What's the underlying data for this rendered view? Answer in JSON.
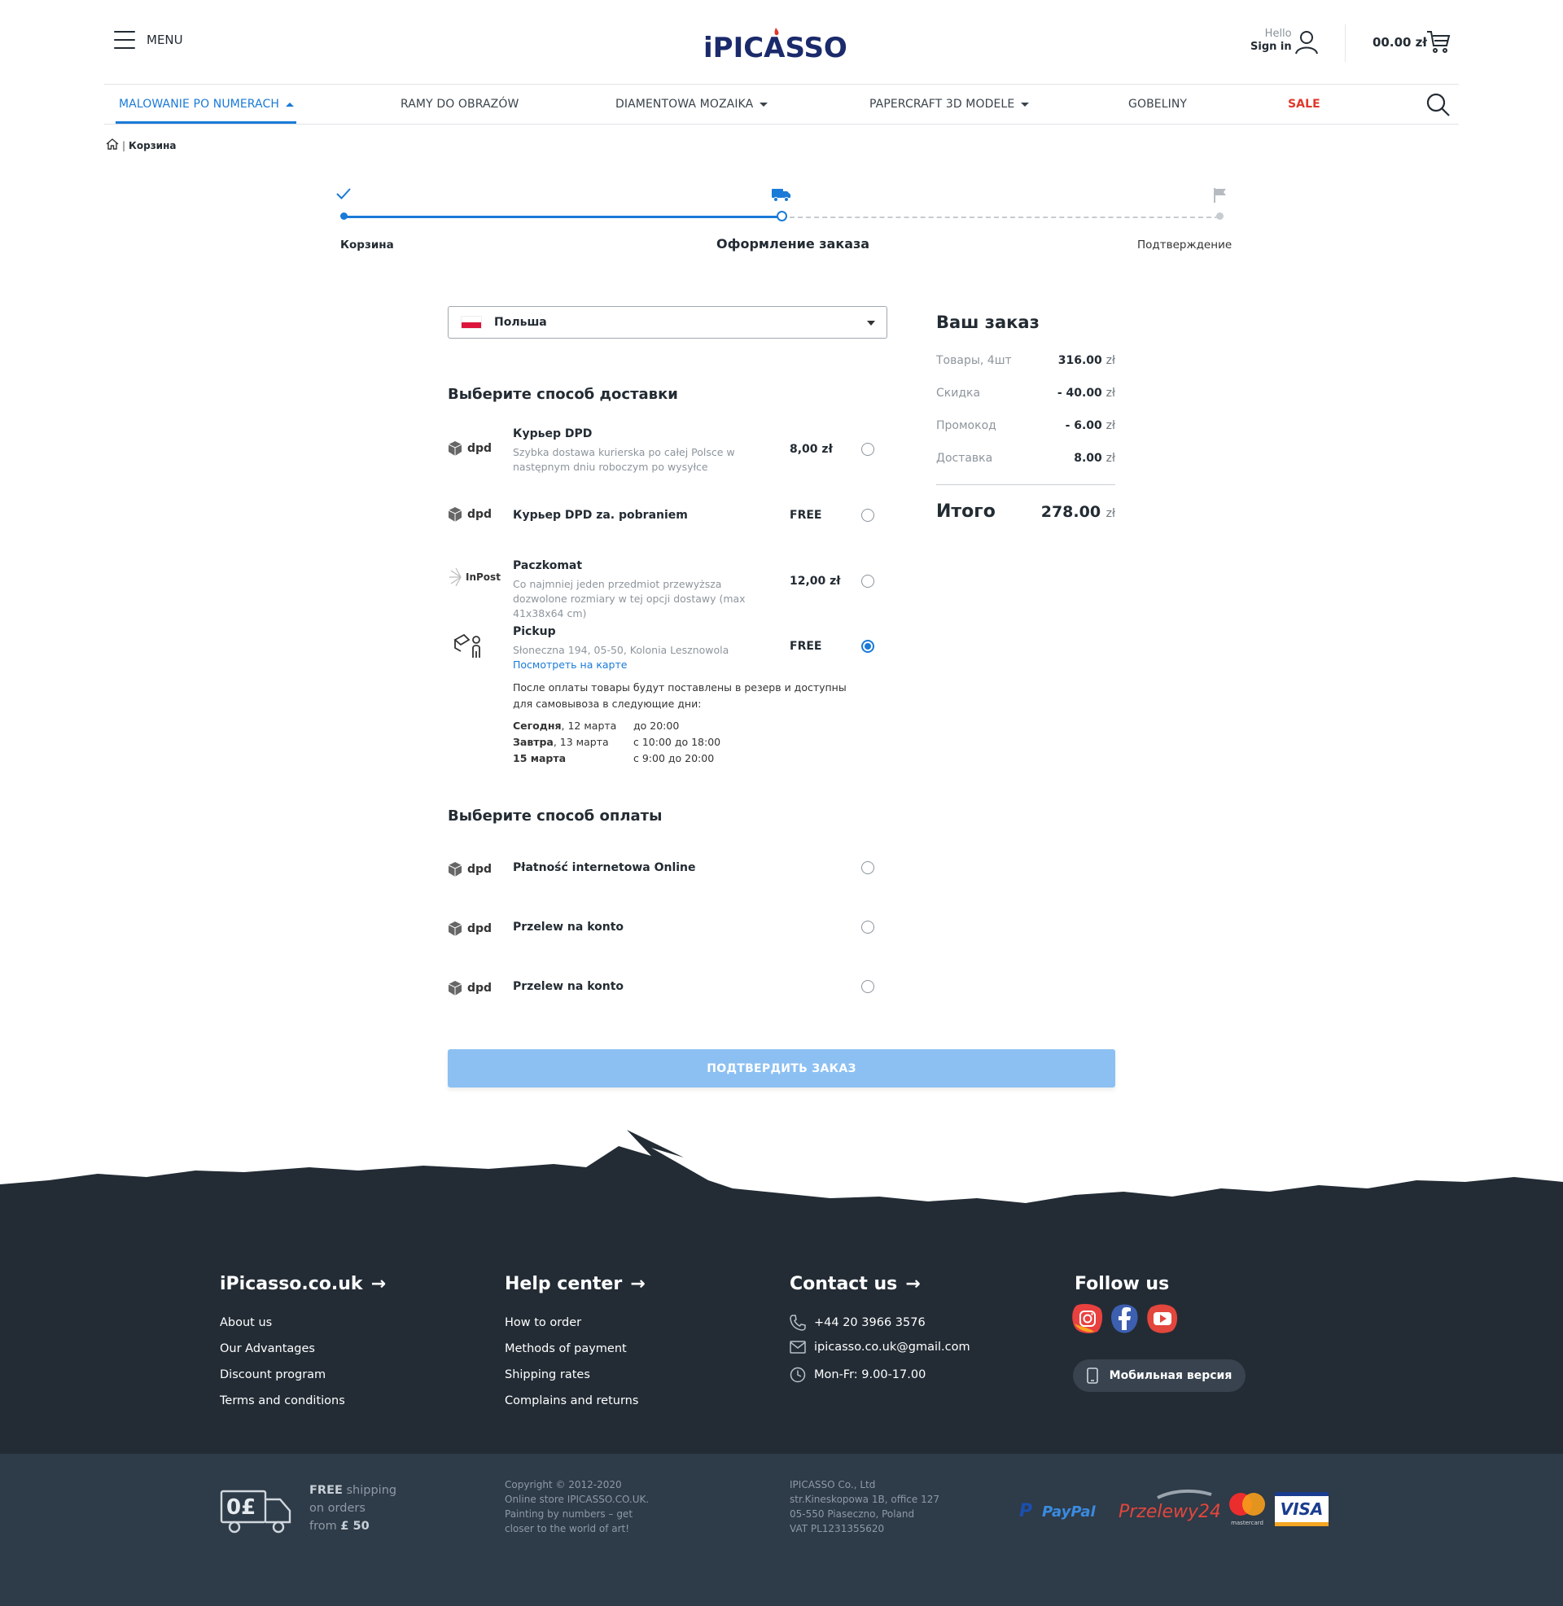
{
  "header": {
    "menu_label": "MENU",
    "logo_text": "iPICASSO",
    "hello": "Hello",
    "sign_in": "Sign in",
    "cart_total": "00.00 zł"
  },
  "nav": {
    "items": [
      {
        "label": "MALOWANIE PO NUMERACH",
        "active": true,
        "dropdown": true
      },
      {
        "label": "RAMY DO OBRAZÓW"
      },
      {
        "label": "DIAMENTOWA MOZAIKA",
        "dropdown": true
      },
      {
        "label": "PAPERCRAFT 3D MODELE",
        "dropdown": true
      },
      {
        "label": "GOBELINY"
      },
      {
        "label": "SALE",
        "color": "#e0382a"
      }
    ]
  },
  "breadcrumb": {
    "sep": "|",
    "current": "Корзина"
  },
  "steps": [
    {
      "label": "Корзина",
      "state": "done",
      "icon": "check-icon"
    },
    {
      "label": "Оформление заказа",
      "state": "current",
      "icon": "truck-icon"
    },
    {
      "label": "Подтверждение",
      "state": "pending",
      "icon": "flag-icon"
    }
  ],
  "country": {
    "selected": "Польша",
    "flag": "poland-flag-icon"
  },
  "delivery": {
    "title": "Выберите способ доставки",
    "options": [
      {
        "logo": "dpd",
        "title": "Курьер DPD",
        "desc": "Szybka dostawa kurierska po całej Polsce w następnym dniu roboczym po wysyłce",
        "price": "8,00 zł",
        "selected": false
      },
      {
        "logo": "dpd",
        "title": "Курьер DPD za. pobraniem",
        "desc": "",
        "price": "FREE",
        "selected": false
      },
      {
        "logo": "InPost",
        "title": "Paczkomat",
        "desc": "Co najmniej jeden przedmiot przewyższa dozwolone rozmiary w tej opcji dostawy (max 41x38x64 cm)",
        "price": "12,00 zł",
        "selected": false
      },
      {
        "logo": "pickup-icon",
        "title": "Pickup",
        "desc": "Słoneczna 194, 05-50, Kolonia Lesznowola",
        "price": "FREE",
        "selected": true
      }
    ],
    "pickup": {
      "map_link": "Посмотреть на карте",
      "note": "После оплаты товары будут поставлены в резерв и доступны для самовывоза в следующие дни:",
      "days": [
        {
          "day_bold": "Сегодня",
          "day_rest": ", 12 марта",
          "time": "до 20:00"
        },
        {
          "day_bold": "Завтра",
          "day_rest": ", 13 марта",
          "time": "с 10:00 до 18:00"
        },
        {
          "day_bold": "15 марта",
          "day_rest": "",
          "time": "с 9:00 до 20:00"
        }
      ]
    }
  },
  "payment": {
    "title": "Выберите способ оплаты",
    "options": [
      {
        "logo": "dpd",
        "title": "Płatność internetowa Online",
        "selected": false
      },
      {
        "logo": "dpd",
        "title": "Przelew na konto",
        "selected": false
      },
      {
        "logo": "dpd",
        "title": "Przelew na konto",
        "selected": false
      }
    ]
  },
  "summary": {
    "title": "Ваш заказ",
    "currency": "zł",
    "rows": [
      {
        "label": "Товары, 4шт",
        "value": "316.00"
      },
      {
        "label": "Скидка",
        "value": "- 40.00"
      },
      {
        "label": "Промокод",
        "value": "- 6.00"
      },
      {
        "label": "Доставка",
        "value": "8.00"
      }
    ],
    "total_label": "Итого",
    "total_value": "278.00"
  },
  "confirm_button": "ПОДТВЕРДИТЬ ЗАКАЗ",
  "footer": {
    "cols": [
      {
        "title": "iPicasso.co.uk",
        "links": [
          "About us",
          "Our Advantages",
          "Discount program",
          "Terms and conditions"
        ]
      },
      {
        "title": "Help center",
        "links": [
          "How to order",
          "Methods of payment",
          "Shipping rates",
          "Complains and returns"
        ]
      },
      {
        "title": "Contact us",
        "links": [
          "+44 20 3966 3576",
          "ipicasso.co.uk@gmail.com",
          "Mon-Fr: 9.00-17.00"
        ]
      }
    ],
    "follow_title": "Follow us",
    "socials": [
      "instagram-icon",
      "facebook-icon",
      "youtube-icon"
    ],
    "mobile_label": "Мобильная версия",
    "shipping": {
      "badge": "0£",
      "free": "FREE",
      "line1": " shipping",
      "line2": "on orders",
      "line3": "from ",
      "amount": "£ 50"
    },
    "copyright": [
      "Copyright © 2012-2020",
      "Online store IPICASSO.CO.UK.",
      "Painting by numbers – get",
      "closer to the world of art!"
    ],
    "company": [
      "IPICASSO Co., Ltd",
      "str.Kineskopowa 1B, office 127",
      "05-550 Piaseczno, Poland",
      "VAT PL1231355620"
    ],
    "payments": {
      "paypal": "PayPal",
      "przelewy": "Przelewy24",
      "mastercard": "mastercard",
      "visa": "VISA"
    }
  },
  "colors": {
    "accent": "#1a7ad8",
    "sale": "#e0382a",
    "footer": "#232c35",
    "footer_bottom": "#2e3b48",
    "button": "#8cc0f2"
  }
}
